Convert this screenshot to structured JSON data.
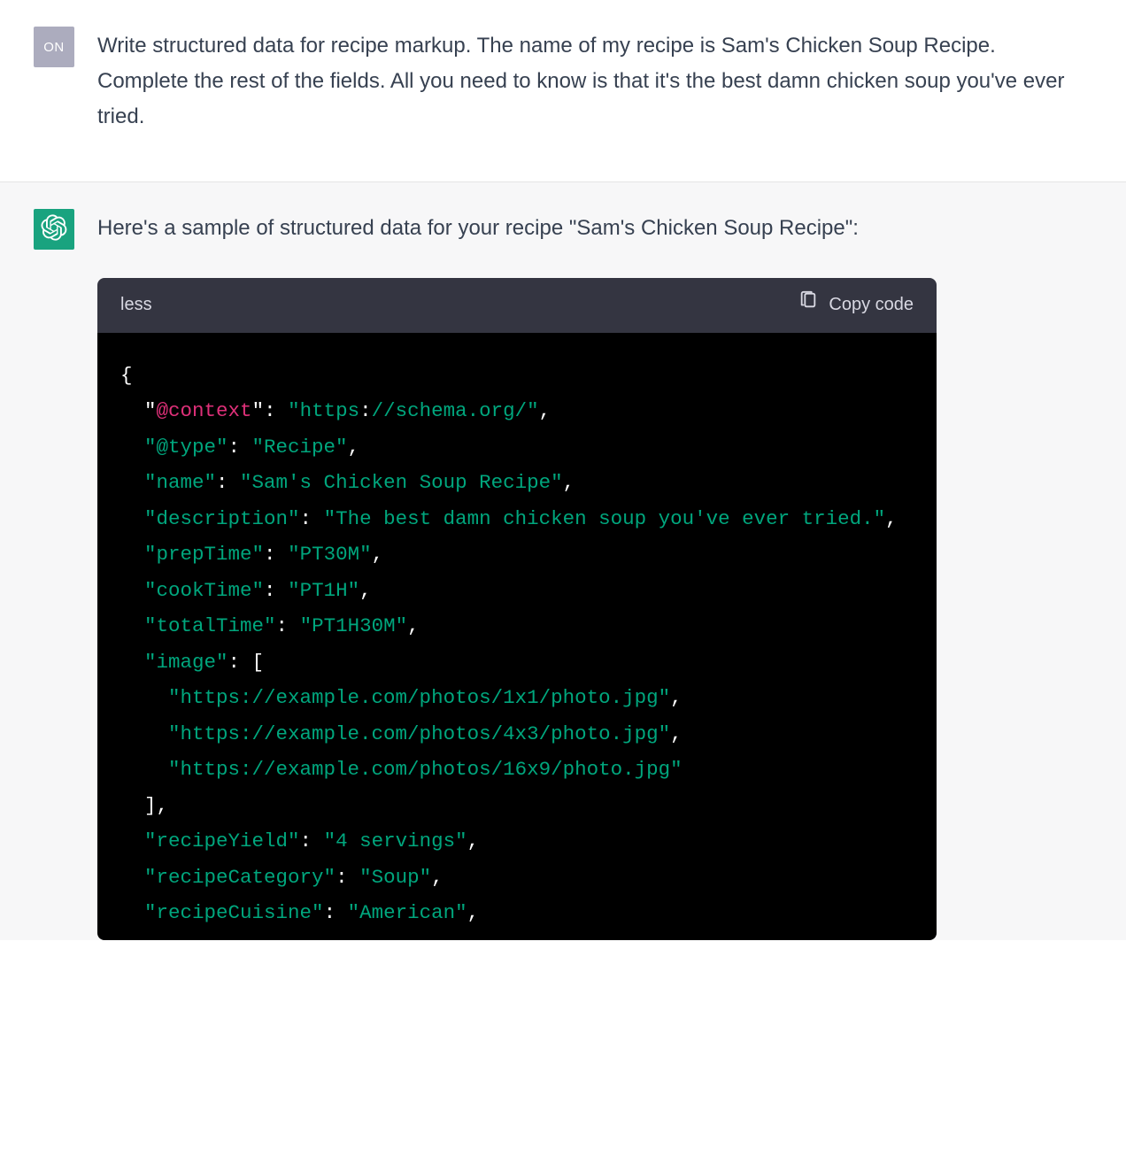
{
  "user": {
    "avatar_label": "ON",
    "text": "Write structured data for recipe markup. The name of my recipe is Sam's Chicken Soup Recipe. Complete the rest of the fields. All you need to know is that it's the best damn chicken soup you've ever tried."
  },
  "assistant": {
    "text": "Here's a sample of structured data for your recipe \"Sam's Chicken Soup Recipe\":",
    "code": {
      "language_label": "less",
      "copy_label": "Copy code",
      "json": {
        "@context": "https://schema.org/",
        "@type": "Recipe",
        "name": "Sam's Chicken Soup Recipe",
        "description": "The best damn chicken soup you've ever tried.",
        "prepTime": "PT30M",
        "cookTime": "PT1H",
        "totalTime": "PT1H30M",
        "image": [
          "https://example.com/photos/1x1/photo.jpg",
          "https://example.com/photos/4x3/photo.jpg",
          "https://example.com/photos/16x9/photo.jpg"
        ],
        "recipeYield": "4 servings",
        "recipeCategory": "Soup",
        "recipeCuisine": "American"
      },
      "tokens": [
        {
          "t": "{",
          "c": "tok-p",
          "nl": true
        },
        {
          "t": "  ",
          "c": "tok-p"
        },
        {
          "t": "\"",
          "c": "tok-w"
        },
        {
          "t": "@context",
          "c": "tok-at"
        },
        {
          "t": "\"",
          "c": "tok-w"
        },
        {
          "t": ": ",
          "c": "tok-w"
        },
        {
          "t": "\"https",
          "c": "tok-str"
        },
        {
          "t": ":",
          "c": "tok-w"
        },
        {
          "t": "//schema.org/\"",
          "c": "tok-url2"
        },
        {
          "t": ",",
          "c": "tok-w",
          "nl": true
        },
        {
          "t": "  ",
          "c": "tok-p"
        },
        {
          "t": "\"@type\"",
          "c": "tok-str"
        },
        {
          "t": ": ",
          "c": "tok-w"
        },
        {
          "t": "\"Recipe\"",
          "c": "tok-str"
        },
        {
          "t": ",",
          "c": "tok-w",
          "nl": true
        },
        {
          "t": "  ",
          "c": "tok-p"
        },
        {
          "t": "\"name\"",
          "c": "tok-str"
        },
        {
          "t": ": ",
          "c": "tok-w"
        },
        {
          "t": "\"Sam's Chicken Soup Recipe\"",
          "c": "tok-str"
        },
        {
          "t": ",",
          "c": "tok-w",
          "nl": true
        },
        {
          "t": "  ",
          "c": "tok-p"
        },
        {
          "t": "\"description\"",
          "c": "tok-str"
        },
        {
          "t": ": ",
          "c": "tok-w"
        },
        {
          "t": "\"The best damn chicken soup you've ever tried.\"",
          "c": "tok-str"
        },
        {
          "t": ",",
          "c": "tok-w",
          "nl": true
        },
        {
          "t": "  ",
          "c": "tok-p"
        },
        {
          "t": "\"prepTime\"",
          "c": "tok-str"
        },
        {
          "t": ": ",
          "c": "tok-w"
        },
        {
          "t": "\"PT30M\"",
          "c": "tok-str"
        },
        {
          "t": ",",
          "c": "tok-w",
          "nl": true
        },
        {
          "t": "  ",
          "c": "tok-p"
        },
        {
          "t": "\"cookTime\"",
          "c": "tok-str"
        },
        {
          "t": ": ",
          "c": "tok-w"
        },
        {
          "t": "\"PT1H\"",
          "c": "tok-str"
        },
        {
          "t": ",",
          "c": "tok-w",
          "nl": true
        },
        {
          "t": "  ",
          "c": "tok-p"
        },
        {
          "t": "\"totalTime\"",
          "c": "tok-str"
        },
        {
          "t": ": ",
          "c": "tok-w"
        },
        {
          "t": "\"PT1H30M\"",
          "c": "tok-str"
        },
        {
          "t": ",",
          "c": "tok-w",
          "nl": true
        },
        {
          "t": "  ",
          "c": "tok-p"
        },
        {
          "t": "\"image\"",
          "c": "tok-str"
        },
        {
          "t": ": ",
          "c": "tok-w"
        },
        {
          "t": "[",
          "c": "tok-w",
          "nl": true
        },
        {
          "t": "    ",
          "c": "tok-p"
        },
        {
          "t": "\"https://example.com/photos/1x1/photo.jpg\"",
          "c": "tok-str"
        },
        {
          "t": ",",
          "c": "tok-w",
          "nl": true
        },
        {
          "t": "    ",
          "c": "tok-p"
        },
        {
          "t": "\"https://example.com/photos/4x3/photo.jpg\"",
          "c": "tok-str"
        },
        {
          "t": ",",
          "c": "tok-w",
          "nl": true
        },
        {
          "t": "    ",
          "c": "tok-p"
        },
        {
          "t": "\"https://example.com/photos/16x9/photo.jpg\"",
          "c": "tok-str"
        },
        {
          "t": "",
          "c": "tok-w",
          "nl": true
        },
        {
          "t": "  ",
          "c": "tok-p"
        },
        {
          "t": "]",
          "c": "tok-w"
        },
        {
          "t": ",",
          "c": "tok-w",
          "nl": true
        },
        {
          "t": "  ",
          "c": "tok-p"
        },
        {
          "t": "\"recipeYield\"",
          "c": "tok-str"
        },
        {
          "t": ": ",
          "c": "tok-w"
        },
        {
          "t": "\"4 servings\"",
          "c": "tok-str"
        },
        {
          "t": ",",
          "c": "tok-w",
          "nl": true
        },
        {
          "t": "  ",
          "c": "tok-p"
        },
        {
          "t": "\"recipeCategory\"",
          "c": "tok-str"
        },
        {
          "t": ": ",
          "c": "tok-w"
        },
        {
          "t": "\"Soup\"",
          "c": "tok-str"
        },
        {
          "t": ",",
          "c": "tok-w",
          "nl": true
        },
        {
          "t": "  ",
          "c": "tok-p"
        },
        {
          "t": "\"recipeCuisine\"",
          "c": "tok-str"
        },
        {
          "t": ": ",
          "c": "tok-w"
        },
        {
          "t": "\"American\"",
          "c": "tok-str"
        },
        {
          "t": ",",
          "c": "tok-w",
          "nl": false
        }
      ]
    }
  }
}
